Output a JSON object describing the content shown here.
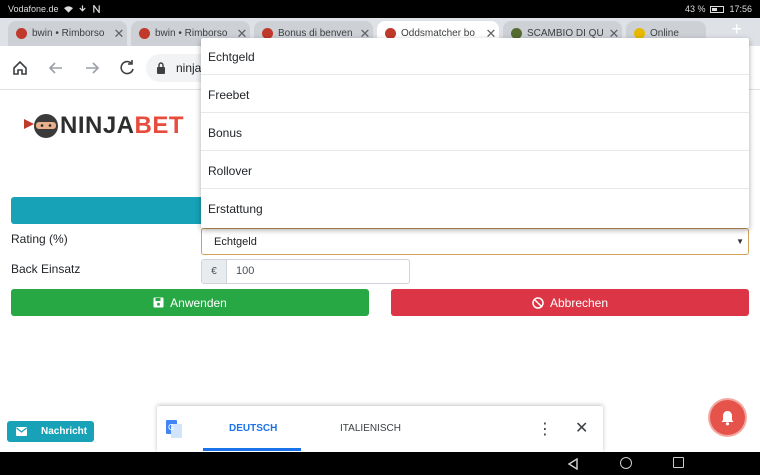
{
  "status_bar": {
    "carrier": "Vodafone.de",
    "battery": "43 %",
    "time": "17:56"
  },
  "tabs": [
    {
      "label": "bwin • Rimborso",
      "favicon_color": "#c0392b"
    },
    {
      "label": "bwin • Rimborso",
      "favicon_color": "#c0392b"
    },
    {
      "label": "Bonus di benven",
      "favicon_color": "#c0392b"
    },
    {
      "label": "Oddsmatcher bo",
      "favicon_color": "#c0392b"
    },
    {
      "label": "SCAMBIO DI QU",
      "favicon_color": "#556b2f"
    },
    {
      "label": "Online",
      "favicon_color": "#e6b800"
    }
  ],
  "omnibox": {
    "url": "ninja"
  },
  "logo": {
    "part1": "NINJA",
    "part2": "BET"
  },
  "form": {
    "rating_label": "Rating (%)",
    "back_label": "Back Einsatz",
    "select_value": "Echtgeld",
    "currency": "€",
    "amount": "100",
    "apply_label": "Anwenden",
    "cancel_label": "Abbrechen"
  },
  "dropdown_options": [
    "Echtgeld",
    "Freebet",
    "Bonus",
    "Rollover",
    "Erstattung"
  ],
  "nachricht": {
    "label": "Nachricht"
  },
  "translate_bar": {
    "lang_active": "DEUTSCH",
    "lang_other": "ITALIENISCH"
  },
  "colors": {
    "teal": "#17a2b8",
    "green": "#28a745",
    "red": "#dc3545",
    "brand_red": "#e74c3c"
  }
}
